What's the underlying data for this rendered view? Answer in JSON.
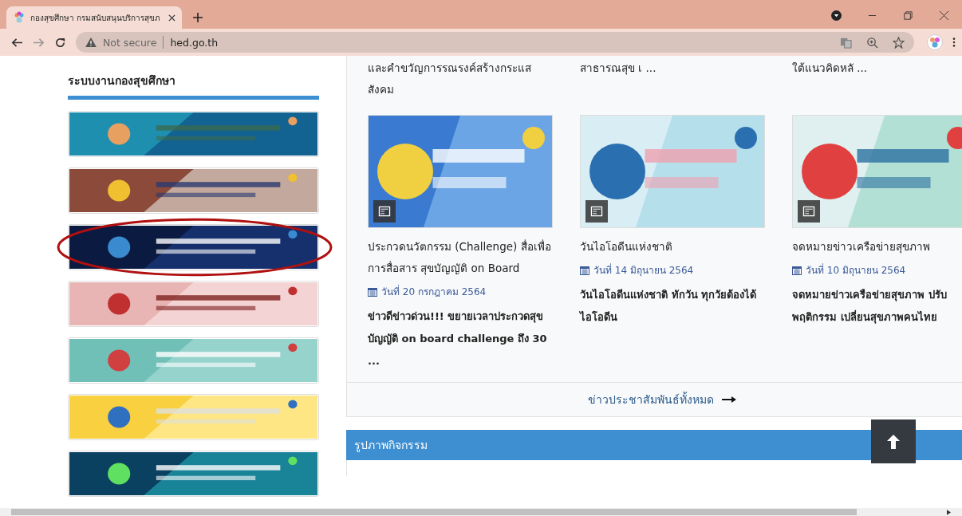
{
  "browser": {
    "tab": {
      "title": "กองสุขศึกษา กรมสนับสนุนบริการสุขภ",
      "selected": true
    },
    "security": "Not secure",
    "url": "hed.go.th"
  },
  "sidebar": {
    "title": "ระบบงานกองสุขศึกษา",
    "banners": [
      {
        "kind": "picture",
        "highlighted": false
      },
      {
        "kind": "picture",
        "highlighted": false
      },
      {
        "kind": "picture",
        "highlighted": true
      },
      {
        "kind": "picture",
        "highlighted": false
      },
      {
        "kind": "picture",
        "highlighted": false
      },
      {
        "kind": "picture",
        "highlighted": false
      },
      {
        "kind": "picture",
        "highlighted": false
      }
    ]
  },
  "news": {
    "previous_snippets": [
      "และคำขวัญการรณรงค์สร้างกระแสสังคม",
      "สาธารณสุข เ ...",
      "ใต้แนวคิดหลั ..."
    ],
    "items": [
      {
        "title": "ประกวดนวัตกรรม (Challenge) สื่อเพื่อการสื่อสาร สุขบัญญัติ on Board",
        "date": "วันที่ 20 กรกฎาคม 2564",
        "summary": "ข่าวดีข่าวด่วน!!! ขยายเวลาประกวดสุขบัญญัติ on board challenge ถึง 30 ..."
      },
      {
        "title": "วันไอโอดีนแห่งชาติ",
        "date": "วันที่ 14 มิถุนายน 2564",
        "summary": "วันไอโอดีนแห่งชาติ ทักวัน ทุกวัยต้องได้ไอโอดีน"
      },
      {
        "title": "จดหมายข่าวเครือข่ายสุขภาพ",
        "date": "วันที่ 10 มิถุนายน 2564",
        "summary": "จดหมายข่าวเครือข่ายสุขภาพ ปรับพฤติกรรม เปลี่ยนสุขภาพคนไทย"
      }
    ],
    "all_link": "ข่าวประชาสัมพันธ์ทั้งหมด"
  },
  "activities": {
    "title": "รูปภาพกิจกรรม"
  }
}
